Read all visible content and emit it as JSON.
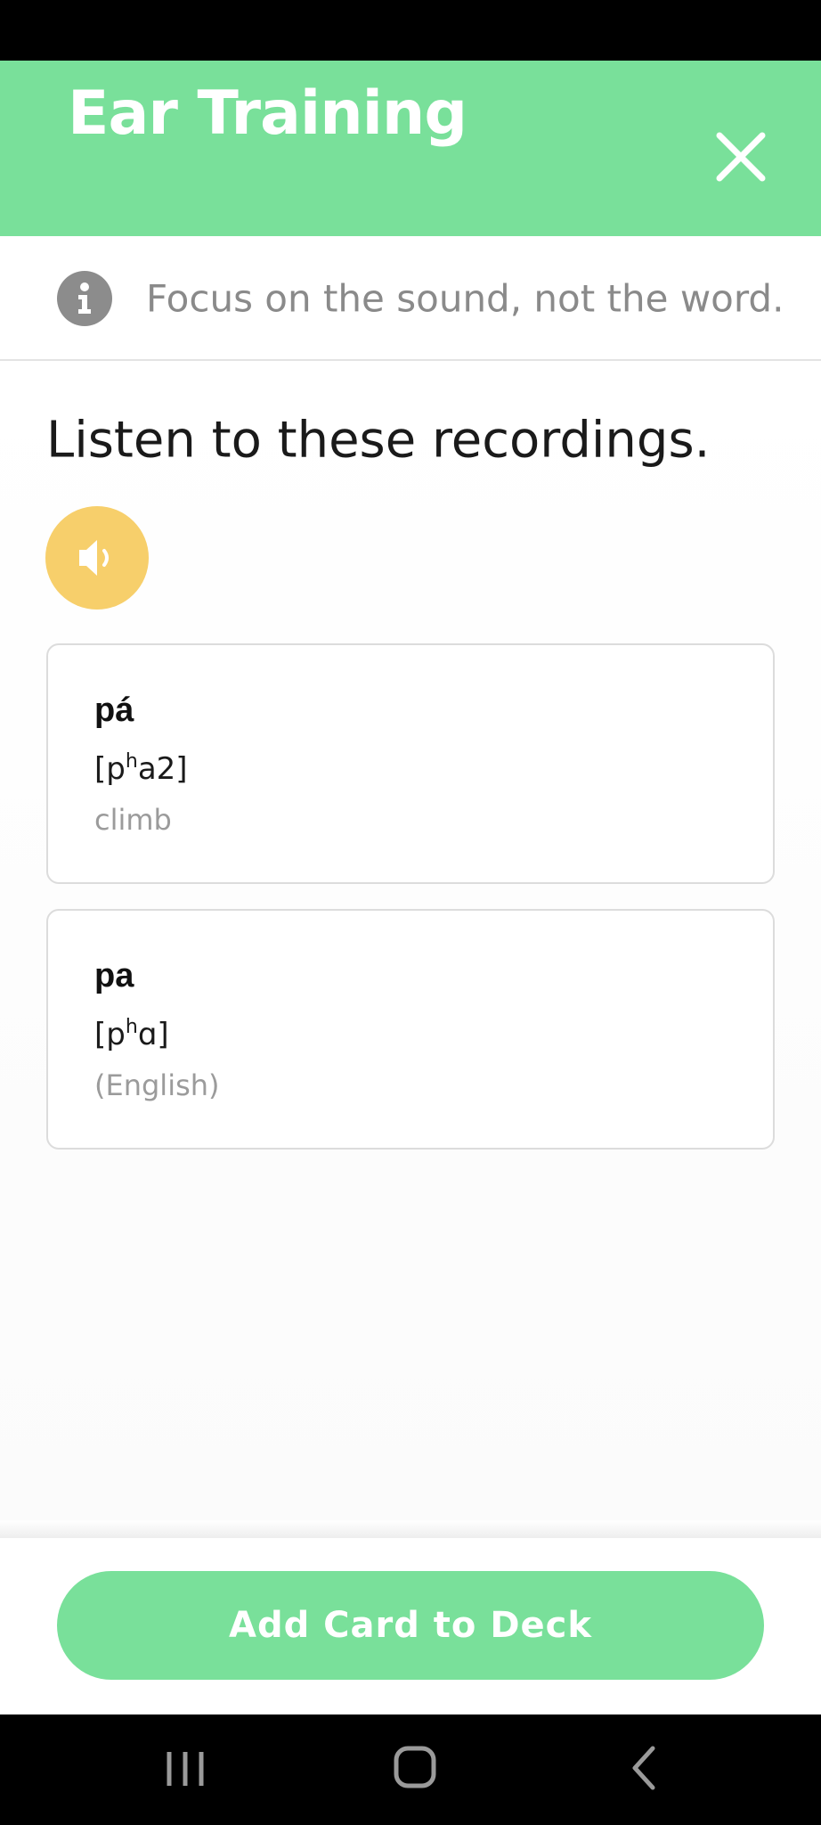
{
  "header": {
    "title": "Ear Training",
    "background_color": "#79e09a",
    "close_icon": "close-icon"
  },
  "info": {
    "icon": "info-icon",
    "text": "Focus on the sound, not the word."
  },
  "main": {
    "prompt": "Listen to these recordings.",
    "audio_button_icon": "speaker-icon",
    "audio_button_color": "#f7cf6b",
    "cards": [
      {
        "word": "pá",
        "ipa_base": "[p",
        "ipa_sup": "h",
        "ipa_rest": "a2]",
        "gloss": "climb"
      },
      {
        "word": "pa",
        "ipa_base": "[p",
        "ipa_sup": "h",
        "ipa_rest": "ɑ]",
        "gloss": "(English)"
      }
    ]
  },
  "footer": {
    "add_button_label": "Add Card to Deck"
  },
  "nav": {
    "recents_icon": "recents-icon",
    "home_icon": "home-icon",
    "back_icon": "back-icon"
  }
}
